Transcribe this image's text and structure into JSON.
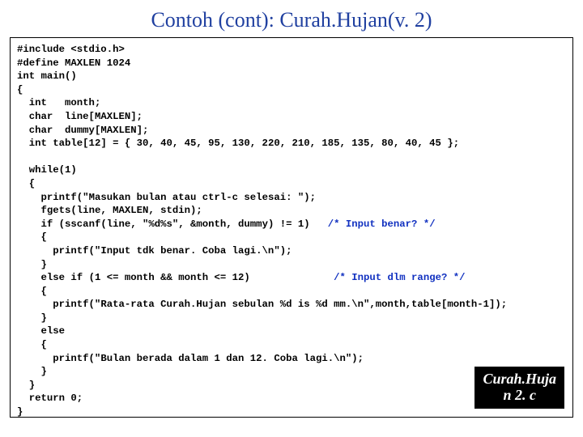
{
  "title": "Contoh (cont): Curah.Hujan(v. 2)",
  "code": {
    "l01": "#include <stdio.h>",
    "l02": "#define MAXLEN 1024",
    "l03": "int main()",
    "l04": "{",
    "l05": "  int   month;",
    "l06": "  char  line[MAXLEN];",
    "l07": "  char  dummy[MAXLEN];",
    "l08": "  int table[12] = { 30, 40, 45, 95, 130, 220, 210, 185, 135, 80, 40, 45 };",
    "l09": "",
    "l10": "  while(1)",
    "l11": "  {",
    "l12": "    printf(\"Masukan bulan atau ctrl-c selesai: \");",
    "l13": "    fgets(line, MAXLEN, stdin);",
    "l14a": "    if (sscanf(line, \"%d%s\", &month, dummy) != 1)   ",
    "l14b": "/* Input benar? */",
    "l15": "    {",
    "l16": "      printf(\"Input tdk benar. Coba lagi.\\n\");",
    "l17": "    }",
    "l18a": "    else if (1 <= month && month <= 12)              ",
    "l18b": "/* Input dlm range? */",
    "l19": "    {",
    "l20": "      printf(\"Rata-rata Curah.Hujan sebulan %d is %d mm.\\n\",month,table[month-1]);",
    "l21": "    }",
    "l22": "    else",
    "l23": "    {",
    "l24": "      printf(\"Bulan berada dalam 1 dan 12. Coba lagi.\\n\");",
    "l25": "    }",
    "l26": "  }",
    "l27": "  return 0;",
    "l28": "}"
  },
  "filename": {
    "line1": "Curah.Huja",
    "line2": "n 2. c"
  }
}
